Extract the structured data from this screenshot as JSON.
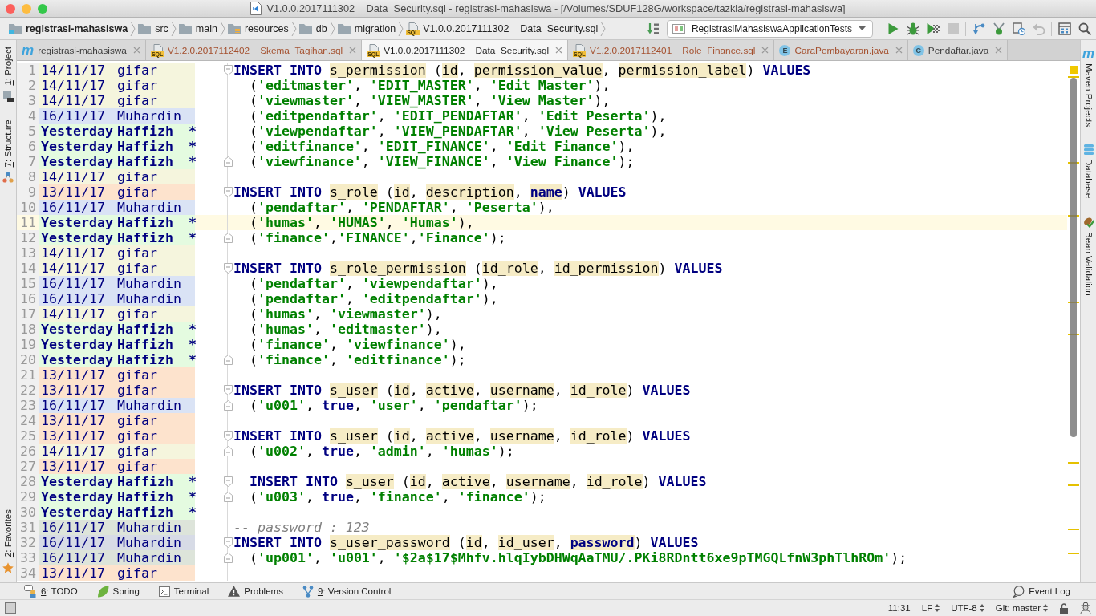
{
  "window": {
    "title": "V1.0.0.2017111302__Data_Security.sql - registrasi-mahasiswa - [/Volumes/SDUF128G/workspace/tazkia/registrasi-mahasiswa]"
  },
  "breadcrumbs": [
    {
      "label": "registrasi-mahasiswa",
      "kind": "module"
    },
    {
      "label": "src",
      "kind": "folder"
    },
    {
      "label": "main",
      "kind": "folder"
    },
    {
      "label": "resources",
      "kind": "resources"
    },
    {
      "label": "db",
      "kind": "folder"
    },
    {
      "label": "migration",
      "kind": "folder"
    },
    {
      "label": "V1.0.0.2017111302__Data_Security.sql",
      "kind": "sql",
      "badge": "SQL"
    }
  ],
  "toolbar": {
    "build_buttons": [
      {
        "kind": "build",
        "disabled": false
      }
    ],
    "run_configuration": "RegistrasiMahasiswaApplicationTests",
    "run_buttons": [
      {
        "kind": "run",
        "disabled": false
      },
      {
        "kind": "debug",
        "disabled": false
      },
      {
        "kind": "coverage",
        "disabled": false
      },
      {
        "kind": "stop",
        "disabled": true
      }
    ],
    "vcs_buttons": [
      {
        "kind": "vcs-update",
        "disabled": false
      },
      {
        "kind": "vcs-commit",
        "disabled": false
      },
      {
        "kind": "history",
        "disabled": false
      },
      {
        "kind": "revert",
        "disabled": true
      }
    ],
    "tool_buttons": [
      {
        "kind": "project-structure",
        "disabled": false
      },
      {
        "kind": "search",
        "disabled": false
      }
    ]
  },
  "tabs": [
    {
      "label": "registrasi-mahasiswa",
      "kind": "maven",
      "badge": "m",
      "color": "#3c3c3c",
      "selected": false
    },
    {
      "label": "V1.2.0.2017112402__Skema_Tagihan.sql",
      "kind": "sql",
      "badge": "SQL",
      "color": "#a4502e",
      "selected": false
    },
    {
      "label": "V1.0.0.2017111302__Data_Security.sql",
      "kind": "sql",
      "badge": "SQL",
      "color": "#1e1e1e",
      "selected": true
    },
    {
      "label": "V1.2.0.2017112401__Role_Finance.sql",
      "kind": "sql",
      "badge": "SQL",
      "color": "#a4502e",
      "selected": false
    },
    {
      "label": "CaraPembayaran.java",
      "kind": "enum",
      "badge": "E",
      "color": "#a4502e",
      "selected": false
    },
    {
      "label": "Pendaftar.java",
      "kind": "class",
      "badge": "C",
      "color": "#3c3c3c",
      "selected": false
    }
  ],
  "left_tool_strip": {
    "top": [
      {
        "label": "1: Project",
        "kind": "project",
        "mnemonic": true
      },
      {
        "label": "7: Structure",
        "kind": "structure",
        "mnemonic": true
      }
    ],
    "bottom": [
      {
        "label": "2: Favorites",
        "kind": "favorites",
        "mnemonic": true
      }
    ]
  },
  "right_tool_strip": [
    {
      "label": "Maven Projects",
      "kind": "maven",
      "badge": "m"
    },
    {
      "label": "Database",
      "kind": "database"
    },
    {
      "label": "Bean Validation",
      "kind": "bean-validation"
    }
  ],
  "editor": {
    "lines": [
      {
        "number": "1",
        "date": "14/11/17",
        "author": "gifar",
        "recent": false,
        "color": "#f5f5dd",
        "current": false,
        "fold": {
          "kind": "start"
        },
        "code": [
          {
            "kind": "keyword",
            "text": "INSERT INTO "
          },
          {
            "kind": "identifier",
            "text": "s_permission"
          },
          {
            "kind": "plain",
            "text": " ("
          },
          {
            "kind": "identifier",
            "text": "id"
          },
          {
            "kind": "plain",
            "text": ", "
          },
          {
            "kind": "identifier",
            "text": "permission_value"
          },
          {
            "kind": "plain",
            "text": ", "
          },
          {
            "kind": "identifier",
            "text": "permission_label"
          },
          {
            "kind": "plain",
            "text": ") "
          },
          {
            "kind": "keyword",
            "text": "VALUES"
          }
        ]
      },
      {
        "number": "2",
        "date": "14/11/17",
        "author": "gifar",
        "recent": false,
        "color": "#f5f5dd",
        "current": false,
        "code": [
          {
            "kind": "plain",
            "text": "  ("
          },
          {
            "kind": "string",
            "text": "'editmaster'"
          },
          {
            "kind": "plain",
            "text": ", "
          },
          {
            "kind": "string",
            "text": "'EDIT_MASTER'"
          },
          {
            "kind": "plain",
            "text": ", "
          },
          {
            "kind": "string",
            "text": "'Edit Master'"
          },
          {
            "kind": "plain",
            "text": "),"
          }
        ]
      },
      {
        "number": "3",
        "date": "14/11/17",
        "author": "gifar",
        "recent": false,
        "color": "#f5f5dd",
        "current": false,
        "code": [
          {
            "kind": "plain",
            "text": "  ("
          },
          {
            "kind": "string",
            "text": "'viewmaster'"
          },
          {
            "kind": "plain",
            "text": ", "
          },
          {
            "kind": "string",
            "text": "'VIEW_MASTER'"
          },
          {
            "kind": "plain",
            "text": ", "
          },
          {
            "kind": "string",
            "text": "'View Master'"
          },
          {
            "kind": "plain",
            "text": "),"
          }
        ]
      },
      {
        "number": "4",
        "date": "16/11/17",
        "author": "Muhardin",
        "recent": false,
        "color": "#dae3f5",
        "current": false,
        "code": [
          {
            "kind": "plain",
            "text": "  ("
          },
          {
            "kind": "string",
            "text": "'editpendaftar'"
          },
          {
            "kind": "plain",
            "text": ", "
          },
          {
            "kind": "string",
            "text": "'EDIT_PENDAFTAR'"
          },
          {
            "kind": "plain",
            "text": ", "
          },
          {
            "kind": "string",
            "text": "'Edit Peserta'"
          },
          {
            "kind": "plain",
            "text": "),"
          }
        ]
      },
      {
        "number": "5",
        "date": "Yesterday",
        "author": "Haffizh",
        "flag": "*",
        "recent": true,
        "color": "#e4fbe0",
        "current": false,
        "code": [
          {
            "kind": "plain",
            "text": "  ("
          },
          {
            "kind": "string",
            "text": "'viewpendaftar'"
          },
          {
            "kind": "plain",
            "text": ", "
          },
          {
            "kind": "string",
            "text": "'VIEW_PENDAFTAR'"
          },
          {
            "kind": "plain",
            "text": ", "
          },
          {
            "kind": "string",
            "text": "'View Peserta'"
          },
          {
            "kind": "plain",
            "text": "),"
          }
        ]
      },
      {
        "number": "6",
        "date": "Yesterday",
        "author": "Haffizh",
        "flag": "*",
        "recent": true,
        "color": "#e4fbe0",
        "current": false,
        "code": [
          {
            "kind": "plain",
            "text": "  ("
          },
          {
            "kind": "string",
            "text": "'editfinance'"
          },
          {
            "kind": "plain",
            "text": ", "
          },
          {
            "kind": "string",
            "text": "'EDIT_FINANCE'"
          },
          {
            "kind": "plain",
            "text": ", "
          },
          {
            "kind": "string",
            "text": "'Edit Finance'"
          },
          {
            "kind": "plain",
            "text": "),"
          }
        ]
      },
      {
        "number": "7",
        "date": "Yesterday",
        "author": "Haffizh",
        "flag": "*",
        "recent": true,
        "color": "#e4fbe0",
        "current": false,
        "fold": {
          "kind": "end"
        },
        "code": [
          {
            "kind": "plain",
            "text": "  ("
          },
          {
            "kind": "string",
            "text": "'viewfinance'"
          },
          {
            "kind": "plain",
            "text": ", "
          },
          {
            "kind": "string",
            "text": "'VIEW_FINANCE'"
          },
          {
            "kind": "plain",
            "text": ", "
          },
          {
            "kind": "string",
            "text": "'View Finance'"
          },
          {
            "kind": "plain",
            "text": ");"
          }
        ]
      },
      {
        "number": "8",
        "date": "14/11/17",
        "author": "gifar",
        "recent": false,
        "color": "#f5f5dd",
        "current": false
      },
      {
        "number": "9",
        "date": "13/11/17",
        "author": "gifar",
        "recent": false,
        "color": "#fde3cd",
        "current": false,
        "fold": {
          "kind": "start"
        },
        "code": [
          {
            "kind": "keyword",
            "text": "INSERT INTO "
          },
          {
            "kind": "identifier",
            "text": "s_role"
          },
          {
            "kind": "plain",
            "text": " ("
          },
          {
            "kind": "identifier",
            "text": "id"
          },
          {
            "kind": "plain",
            "text": ", "
          },
          {
            "kind": "identifier",
            "text": "description"
          },
          {
            "kind": "plain",
            "text": ", "
          },
          {
            "kind": "keyword-identifier",
            "text": "name"
          },
          {
            "kind": "plain",
            "text": ") "
          },
          {
            "kind": "keyword",
            "text": "VALUES"
          }
        ]
      },
      {
        "number": "10",
        "date": "16/11/17",
        "author": "Muhardin",
        "recent": false,
        "color": "#dae3f5",
        "current": false,
        "code": [
          {
            "kind": "plain",
            "text": "  ("
          },
          {
            "kind": "string",
            "text": "'pendaftar'"
          },
          {
            "kind": "plain",
            "text": ", "
          },
          {
            "kind": "string",
            "text": "'PENDAFTAR'"
          },
          {
            "kind": "plain",
            "text": ", "
          },
          {
            "kind": "string",
            "text": "'Peserta'"
          },
          {
            "kind": "plain",
            "text": "),"
          }
        ]
      },
      {
        "number": "11",
        "date": "Yesterday",
        "author": "Haffizh",
        "flag": "*",
        "recent": true,
        "color": "#e4fbe0",
        "current": true,
        "code": [
          {
            "kind": "plain",
            "text": "  ("
          },
          {
            "kind": "string",
            "text": "'humas'"
          },
          {
            "kind": "plain",
            "text": ", "
          },
          {
            "kind": "string",
            "text": "'HUMAS'"
          },
          {
            "kind": "plain",
            "text": ", "
          },
          {
            "kind": "string",
            "text": "'Humas'"
          },
          {
            "kind": "plain",
            "text": "),"
          }
        ]
      },
      {
        "number": "12",
        "date": "Yesterday",
        "author": "Haffizh",
        "flag": "*",
        "recent": true,
        "color": "#e4fbe0",
        "current": false,
        "fold": {
          "kind": "end"
        },
        "code": [
          {
            "kind": "plain",
            "text": "  ("
          },
          {
            "kind": "string",
            "text": "'finance'"
          },
          {
            "kind": "plain",
            "text": ","
          },
          {
            "kind": "string",
            "text": "'FINANCE'"
          },
          {
            "kind": "plain",
            "text": ","
          },
          {
            "kind": "string",
            "text": "'Finance'"
          },
          {
            "kind": "plain",
            "text": ");"
          }
        ]
      },
      {
        "number": "13",
        "date": "14/11/17",
        "author": "gifar",
        "recent": false,
        "color": "#f5f5dd",
        "current": false
      },
      {
        "number": "14",
        "date": "14/11/17",
        "author": "gifar",
        "recent": false,
        "color": "#f5f5dd",
        "current": false,
        "fold": {
          "kind": "start"
        },
        "code": [
          {
            "kind": "keyword",
            "text": "INSERT INTO "
          },
          {
            "kind": "identifier",
            "text": "s_role_permission"
          },
          {
            "kind": "plain",
            "text": " ("
          },
          {
            "kind": "identifier",
            "text": "id_role"
          },
          {
            "kind": "plain",
            "text": ", "
          },
          {
            "kind": "identifier",
            "text": "id_permission"
          },
          {
            "kind": "plain",
            "text": ") "
          },
          {
            "kind": "keyword",
            "text": "VALUES"
          }
        ]
      },
      {
        "number": "15",
        "date": "16/11/17",
        "author": "Muhardin",
        "recent": false,
        "color": "#dae3f5",
        "current": false,
        "code": [
          {
            "kind": "plain",
            "text": "  ("
          },
          {
            "kind": "string",
            "text": "'pendaftar'"
          },
          {
            "kind": "plain",
            "text": ", "
          },
          {
            "kind": "string",
            "text": "'viewpendaftar'"
          },
          {
            "kind": "plain",
            "text": "),"
          }
        ]
      },
      {
        "number": "16",
        "date": "16/11/17",
        "author": "Muhardin",
        "recent": false,
        "color": "#dae3f5",
        "current": false,
        "code": [
          {
            "kind": "plain",
            "text": "  ("
          },
          {
            "kind": "string",
            "text": "'pendaftar'"
          },
          {
            "kind": "plain",
            "text": ", "
          },
          {
            "kind": "string",
            "text": "'editpendaftar'"
          },
          {
            "kind": "plain",
            "text": "),"
          }
        ]
      },
      {
        "number": "17",
        "date": "14/11/17",
        "author": "gifar",
        "recent": false,
        "color": "#f5f5dd",
        "current": false,
        "code": [
          {
            "kind": "plain",
            "text": "  ("
          },
          {
            "kind": "string",
            "text": "'humas'"
          },
          {
            "kind": "plain",
            "text": ", "
          },
          {
            "kind": "string",
            "text": "'viewmaster'"
          },
          {
            "kind": "plain",
            "text": "),"
          }
        ]
      },
      {
        "number": "18",
        "date": "Yesterday",
        "author": "Haffizh",
        "flag": "*",
        "recent": true,
        "color": "#e4fbe0",
        "current": false,
        "code": [
          {
            "kind": "plain",
            "text": "  ("
          },
          {
            "kind": "string",
            "text": "'humas'"
          },
          {
            "kind": "plain",
            "text": ", "
          },
          {
            "kind": "string",
            "text": "'editmaster'"
          },
          {
            "kind": "plain",
            "text": "),"
          }
        ]
      },
      {
        "number": "19",
        "date": "Yesterday",
        "author": "Haffizh",
        "flag": "*",
        "recent": true,
        "color": "#e4fbe0",
        "current": false,
        "code": [
          {
            "kind": "plain",
            "text": "  ("
          },
          {
            "kind": "string",
            "text": "'finance'"
          },
          {
            "kind": "plain",
            "text": ", "
          },
          {
            "kind": "string",
            "text": "'viewfinance'"
          },
          {
            "kind": "plain",
            "text": "),"
          }
        ]
      },
      {
        "number": "20",
        "date": "Yesterday",
        "author": "Haffizh",
        "flag": "*",
        "recent": true,
        "color": "#e4fbe0",
        "current": false,
        "fold": {
          "kind": "end"
        },
        "code": [
          {
            "kind": "plain",
            "text": "  ("
          },
          {
            "kind": "string",
            "text": "'finance'"
          },
          {
            "kind": "plain",
            "text": ", "
          },
          {
            "kind": "string",
            "text": "'editfinance'"
          },
          {
            "kind": "plain",
            "text": ");"
          }
        ]
      },
      {
        "number": "21",
        "date": "13/11/17",
        "author": "gifar",
        "recent": false,
        "color": "#fde3cd",
        "current": false
      },
      {
        "number": "22",
        "date": "13/11/17",
        "author": "gifar",
        "recent": false,
        "color": "#fde3cd",
        "current": false,
        "fold": {
          "kind": "start"
        },
        "code": [
          {
            "kind": "keyword",
            "text": "INSERT INTO "
          },
          {
            "kind": "identifier",
            "text": "s_user"
          },
          {
            "kind": "plain",
            "text": " ("
          },
          {
            "kind": "identifier",
            "text": "id"
          },
          {
            "kind": "plain",
            "text": ", "
          },
          {
            "kind": "identifier",
            "text": "active"
          },
          {
            "kind": "plain",
            "text": ", "
          },
          {
            "kind": "identifier",
            "text": "username"
          },
          {
            "kind": "plain",
            "text": ", "
          },
          {
            "kind": "identifier",
            "text": "id_role"
          },
          {
            "kind": "plain",
            "text": ") "
          },
          {
            "kind": "keyword",
            "text": "VALUES"
          }
        ]
      },
      {
        "number": "23",
        "date": "16/11/17",
        "author": "Muhardin",
        "recent": false,
        "color": "#dae3f5",
        "current": false,
        "fold": {
          "kind": "end"
        },
        "code": [
          {
            "kind": "plain",
            "text": "  ("
          },
          {
            "kind": "string",
            "text": "'u001'"
          },
          {
            "kind": "plain",
            "text": ", "
          },
          {
            "kind": "keyword",
            "text": "true"
          },
          {
            "kind": "plain",
            "text": ", "
          },
          {
            "kind": "string",
            "text": "'user'"
          },
          {
            "kind": "plain",
            "text": ", "
          },
          {
            "kind": "string",
            "text": "'pendaftar'"
          },
          {
            "kind": "plain",
            "text": ");"
          }
        ]
      },
      {
        "number": "24",
        "date": "13/11/17",
        "author": "gifar",
        "recent": false,
        "color": "#fde3cd",
        "current": false
      },
      {
        "number": "25",
        "date": "13/11/17",
        "author": "gifar",
        "recent": false,
        "color": "#fde3cd",
        "current": false,
        "fold": {
          "kind": "start"
        },
        "code": [
          {
            "kind": "keyword",
            "text": "INSERT INTO "
          },
          {
            "kind": "identifier",
            "text": "s_user"
          },
          {
            "kind": "plain",
            "text": " ("
          },
          {
            "kind": "identifier",
            "text": "id"
          },
          {
            "kind": "plain",
            "text": ", "
          },
          {
            "kind": "identifier",
            "text": "active"
          },
          {
            "kind": "plain",
            "text": ", "
          },
          {
            "kind": "identifier",
            "text": "username"
          },
          {
            "kind": "plain",
            "text": ", "
          },
          {
            "kind": "identifier",
            "text": "id_role"
          },
          {
            "kind": "plain",
            "text": ") "
          },
          {
            "kind": "keyword",
            "text": "VALUES"
          }
        ]
      },
      {
        "number": "26",
        "date": "14/11/17",
        "author": "gifar",
        "recent": false,
        "color": "#f5f5dd",
        "current": false,
        "fold": {
          "kind": "end"
        },
        "code": [
          {
            "kind": "plain",
            "text": "  ("
          },
          {
            "kind": "string",
            "text": "'u002'"
          },
          {
            "kind": "plain",
            "text": ", "
          },
          {
            "kind": "keyword",
            "text": "true"
          },
          {
            "kind": "plain",
            "text": ", "
          },
          {
            "kind": "string",
            "text": "'admin'"
          },
          {
            "kind": "plain",
            "text": ", "
          },
          {
            "kind": "string",
            "text": "'humas'"
          },
          {
            "kind": "plain",
            "text": ");"
          }
        ]
      },
      {
        "number": "27",
        "date": "13/11/17",
        "author": "gifar",
        "recent": false,
        "color": "#fde3cd",
        "current": false
      },
      {
        "number": "28",
        "date": "Yesterday",
        "author": "Haffizh",
        "flag": "*",
        "recent": true,
        "color": "#e4fbe0",
        "current": false,
        "fold": {
          "kind": "start"
        },
        "code": [
          {
            "kind": "keyword",
            "text": "  INSERT INTO "
          },
          {
            "kind": "identifier",
            "text": "s_user"
          },
          {
            "kind": "plain",
            "text": " ("
          },
          {
            "kind": "identifier",
            "text": "id"
          },
          {
            "kind": "plain",
            "text": ", "
          },
          {
            "kind": "identifier",
            "text": "active"
          },
          {
            "kind": "plain",
            "text": ", "
          },
          {
            "kind": "identifier",
            "text": "username"
          },
          {
            "kind": "plain",
            "text": ", "
          },
          {
            "kind": "identifier",
            "text": "id_role"
          },
          {
            "kind": "plain",
            "text": ") "
          },
          {
            "kind": "keyword",
            "text": "VALUES"
          }
        ]
      },
      {
        "number": "29",
        "date": "Yesterday",
        "author": "Haffizh",
        "flag": "*",
        "recent": true,
        "color": "#e4fbe0",
        "current": false,
        "fold": {
          "kind": "end"
        },
        "code": [
          {
            "kind": "plain",
            "text": "  ("
          },
          {
            "kind": "string",
            "text": "'u003'"
          },
          {
            "kind": "plain",
            "text": ", "
          },
          {
            "kind": "keyword",
            "text": "true"
          },
          {
            "kind": "plain",
            "text": ", "
          },
          {
            "kind": "string",
            "text": "'finance'"
          },
          {
            "kind": "plain",
            "text": ", "
          },
          {
            "kind": "string",
            "text": "'finance'"
          },
          {
            "kind": "plain",
            "text": ");"
          }
        ]
      },
      {
        "number": "30",
        "date": "Yesterday",
        "author": "Haffizh",
        "flag": "*",
        "recent": true,
        "color": "#e4fbe0",
        "current": false
      },
      {
        "number": "31",
        "date": "16/11/17",
        "author": "Muhardin",
        "recent": false,
        "color": "#dde4da",
        "current": false,
        "code": [
          {
            "kind": "comment",
            "text": "-- password : 123"
          }
        ]
      },
      {
        "number": "32",
        "date": "16/11/17",
        "author": "Muhardin",
        "recent": false,
        "color": "#d7dbe6",
        "current": false,
        "fold": {
          "kind": "start"
        },
        "code": [
          {
            "kind": "keyword",
            "text": "INSERT INTO "
          },
          {
            "kind": "identifier",
            "text": "s_user_password"
          },
          {
            "kind": "plain",
            "text": " ("
          },
          {
            "kind": "identifier",
            "text": "id"
          },
          {
            "kind": "plain",
            "text": ", "
          },
          {
            "kind": "identifier",
            "text": "id_user"
          },
          {
            "kind": "plain",
            "text": ", "
          },
          {
            "kind": "keyword-identifier",
            "text": "password"
          },
          {
            "kind": "plain",
            "text": ") "
          },
          {
            "kind": "keyword",
            "text": "VALUES"
          }
        ]
      },
      {
        "number": "33",
        "date": "16/11/17",
        "author": "Muhardin",
        "recent": false,
        "color": "#dde4da",
        "current": false,
        "fold": {
          "kind": "end"
        },
        "code": [
          {
            "kind": "plain",
            "text": "  ("
          },
          {
            "kind": "string",
            "text": "'up001'"
          },
          {
            "kind": "plain",
            "text": ", "
          },
          {
            "kind": "string",
            "text": "'u001'"
          },
          {
            "kind": "plain",
            "text": ", "
          },
          {
            "kind": "string",
            "text": "'$2a$17$Mhfv.hlqIybDHWqAaTMU/.PKi8RDntt6xe9pTMGQLfnW3phTlhROm'"
          },
          {
            "kind": "plain",
            "text": ");"
          }
        ]
      },
      {
        "number": "34",
        "date": "13/11/17",
        "author": "gifar",
        "recent": false,
        "color": "#fde3cd",
        "current": false
      }
    ]
  },
  "tool_window_bar": {
    "left": [
      {
        "label": "6: TODO",
        "kind": "todo",
        "mnemonic": true
      },
      {
        "label": "Spring",
        "kind": "spring",
        "mnemonic": false
      },
      {
        "label": "Terminal",
        "kind": "terminal",
        "mnemonic": false
      },
      {
        "label": "Problems",
        "kind": "problems",
        "mnemonic": false
      },
      {
        "label": "9: Version Control",
        "kind": "vcs",
        "mnemonic": true
      }
    ],
    "right": [
      {
        "label": "Event Log",
        "kind": "event-log",
        "mnemonic": false
      }
    ]
  },
  "status_bar": {
    "caret_position": "11:31",
    "line_separator": "LF",
    "encoding": "UTF-8",
    "vcs_branch": "Git: master"
  }
}
